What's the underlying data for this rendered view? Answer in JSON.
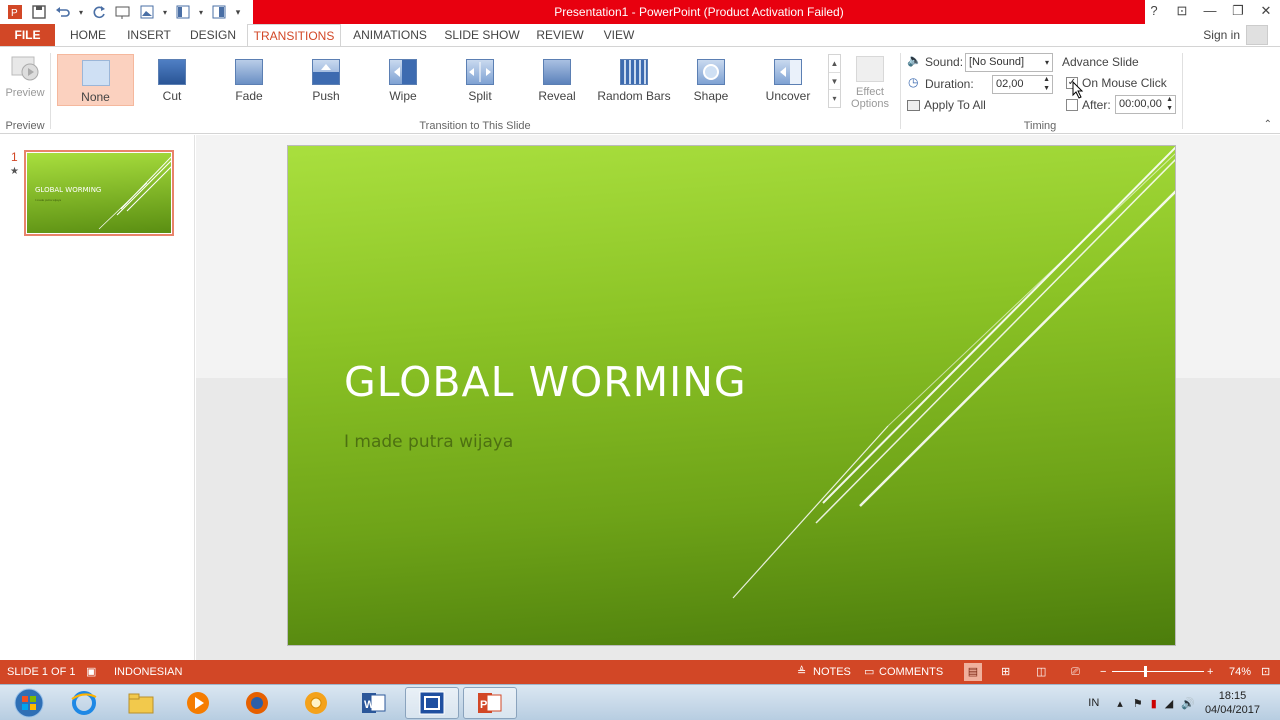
{
  "window": {
    "title": "Presentation1  -  PowerPoint (Product Activation Failed)",
    "help": "?",
    "ribbon_display": "⊡",
    "minimize": "—",
    "restore": "❐",
    "close": "✕"
  },
  "qat": [
    "ppt-logo-icon",
    "save-icon",
    "undo-icon",
    "redo-icon",
    "slideshow-from-start-icon",
    "picture-icon",
    "layout-icon",
    "customize-icon"
  ],
  "tabs": {
    "file": "FILE",
    "home": "HOME",
    "insert": "INSERT",
    "design": "DESIGN",
    "transitions": "TRANSITIONS",
    "animations": "ANIMATIONS",
    "slideshow": "SLIDE SHOW",
    "review": "REVIEW",
    "view": "VIEW"
  },
  "signin": "Sign in",
  "ribbon": {
    "preview": {
      "label": "Preview",
      "group": "Preview"
    },
    "transitions": {
      "group": "Transition to This Slide",
      "items": [
        {
          "label": "None",
          "selected": true
        },
        {
          "label": "Cut"
        },
        {
          "label": "Fade"
        },
        {
          "label": "Push"
        },
        {
          "label": "Wipe"
        },
        {
          "label": "Split"
        },
        {
          "label": "Reveal"
        },
        {
          "label": "Random Bars"
        },
        {
          "label": "Shape"
        },
        {
          "label": "Uncover"
        }
      ]
    },
    "effect_options": {
      "line1": "Effect",
      "line2": "Options"
    },
    "timing": {
      "group": "Timing",
      "sound_label": "Sound:",
      "sound_value": "[No Sound]",
      "duration_label": "Duration:",
      "duration_value": "02,00",
      "apply_all": "Apply To All",
      "advance_label": "Advance Slide",
      "on_mouse_click": "On Mouse Click",
      "on_mouse_click_checked": true,
      "after_label": "After:",
      "after_checked": false,
      "after_value": "00:00,00"
    }
  },
  "thumbnails": [
    {
      "number": "1",
      "star": "★",
      "title": "GLOBAL WORMING",
      "subtitle": "I made putra wijaya"
    }
  ],
  "slide": {
    "title": "GLOBAL WORMING",
    "subtitle": "I made putra wijaya"
  },
  "status": {
    "slide": "SLIDE 1 OF 1",
    "language": "INDONESIAN",
    "notes": "NOTES",
    "comments": "COMMENTS",
    "zoom": "74%"
  },
  "taskbar": {
    "apps": [
      "start-orb-icon",
      "internet-explorer-icon",
      "file-explorer-icon",
      "media-player-icon",
      "firefox-icon",
      "chrome-canary-icon",
      "word-icon",
      "remote-app-icon",
      "powerpoint-icon"
    ],
    "lang": "IN",
    "time": "18:15",
    "date": "04/04/2017"
  },
  "colors": {
    "accent": "#d24726",
    "title_bar": "#e8000f",
    "slide_green": "#8cc426"
  }
}
